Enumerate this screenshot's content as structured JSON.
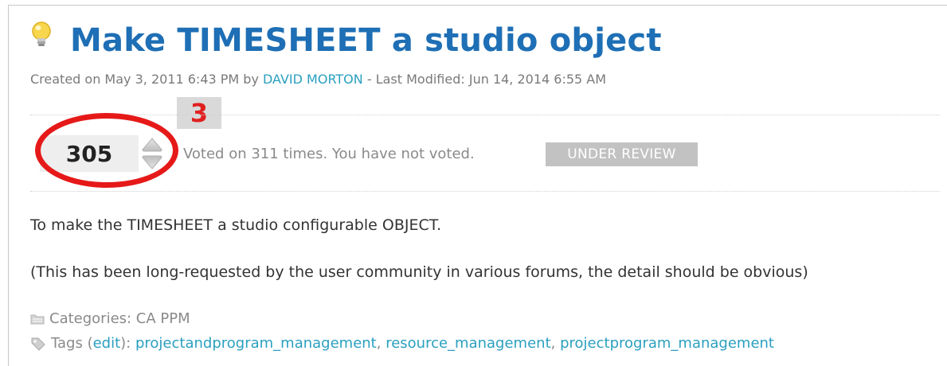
{
  "idea": {
    "title": "Make TIMESHEET a studio object",
    "meta": {
      "created_prefix": "Created on May 3, 2011 6:43 PM by",
      "author": "DAVID MORTON",
      "modified": "- Last Modified: Jun 14, 2014 6:55 AM"
    },
    "vote": {
      "count": "305",
      "summary": "Voted on 311 times.  You have not voted."
    },
    "status": "UNDER REVIEW",
    "description": [
      "To make the TIMESHEET a studio configurable OBJECT.",
      "(This has been long-requested by the user community in various forums, the detail should be obvious)"
    ],
    "categories": {
      "label": "Categories: CA PPM"
    },
    "tags": {
      "label_prefix": "Tags (",
      "edit": "edit",
      "label_suffix": "):",
      "items": [
        "projectandprogram_management",
        "resource_management",
        "projectprogram_management"
      ],
      "separator": ","
    }
  },
  "annotation": {
    "number": "3",
    "ring_color": "#e61919",
    "number_color": "#e02020"
  },
  "colors": {
    "title": "#1e6fb5",
    "link": "#2a9fbf",
    "badge_bg": "#c2c2c2"
  },
  "icons": {
    "idea": "lightbulb-icon",
    "vote_up": "arrow-up-icon",
    "vote_down": "arrow-down-icon",
    "categories": "folder-icon",
    "tags": "tag-icon"
  }
}
